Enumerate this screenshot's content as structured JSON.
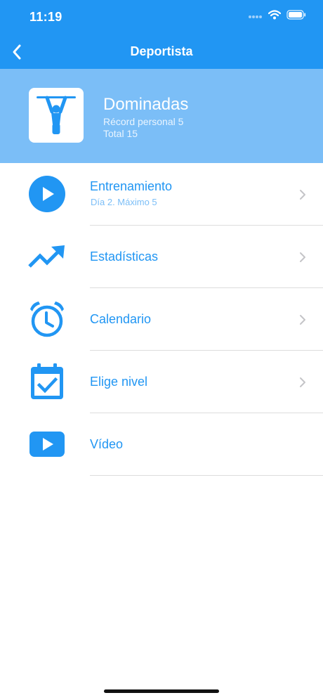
{
  "status_bar": {
    "time": "11:19"
  },
  "nav": {
    "title": "Deportista",
    "back_icon": "chevron-left-icon"
  },
  "exercise": {
    "name": "Dominadas",
    "record": "Récord personal 5",
    "total": "Total 15",
    "icon": "pull-up-icon"
  },
  "menu": [
    {
      "label": "Entrenamiento",
      "sublabel": "Día 2. Máximo 5",
      "icon": "play-circle-icon"
    },
    {
      "label": "Estadísticas",
      "icon": "trending-up-icon"
    },
    {
      "label": "Calendario",
      "icon": "alarm-clock-icon"
    },
    {
      "label": "Elige nivel",
      "icon": "calendar-check-icon"
    },
    {
      "label": "Vídeo",
      "icon": "video-play-icon"
    }
  ],
  "colors": {
    "primary": "#2196F3",
    "header_bg": "#7BBEF7",
    "divider": "#dddddd",
    "chevron": "#c4c4c7"
  }
}
